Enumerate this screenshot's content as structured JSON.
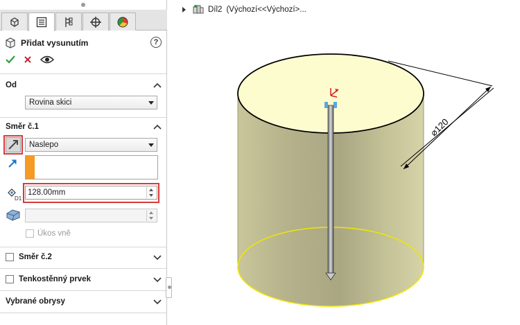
{
  "panel": {
    "tabs": [
      {
        "icon": "feature-manager-icon"
      },
      {
        "icon": "property-manager-icon"
      },
      {
        "icon": "configuration-manager-icon"
      },
      {
        "icon": "dimxpert-icon"
      },
      {
        "icon": "display-manager-icon"
      }
    ],
    "title": "Přidat vysunutím",
    "help_label": "?",
    "from": {
      "section_title": "Od",
      "selected": "Rovina skici"
    },
    "direction1": {
      "section_title": "Směr č.1",
      "end_condition": "Naslepo",
      "depth_value": "128.00mm",
      "draft_label": "Úkos vně"
    },
    "direction2": {
      "section_title": "Směr č.2"
    },
    "thin_feature": {
      "section_title": "Tenkostěnný prvek"
    },
    "selected_contours": {
      "section_title": "Vybrané obrysy"
    }
  },
  "tree": {
    "part_name": "Díl2",
    "config": "(Výchozí<<Výchozí>..."
  },
  "viewport": {
    "dimension_label": "⌀120",
    "cylinder_top_color": "#fdfccf",
    "cylinder_side_color": "#c8c59a",
    "bottom_edge_color": "#f0e600"
  },
  "colors": {
    "accept": "#2f9e3a",
    "cancel": "#c0282d",
    "highlight_red": "#d63a3a",
    "orange_marker": "#f59a23"
  }
}
